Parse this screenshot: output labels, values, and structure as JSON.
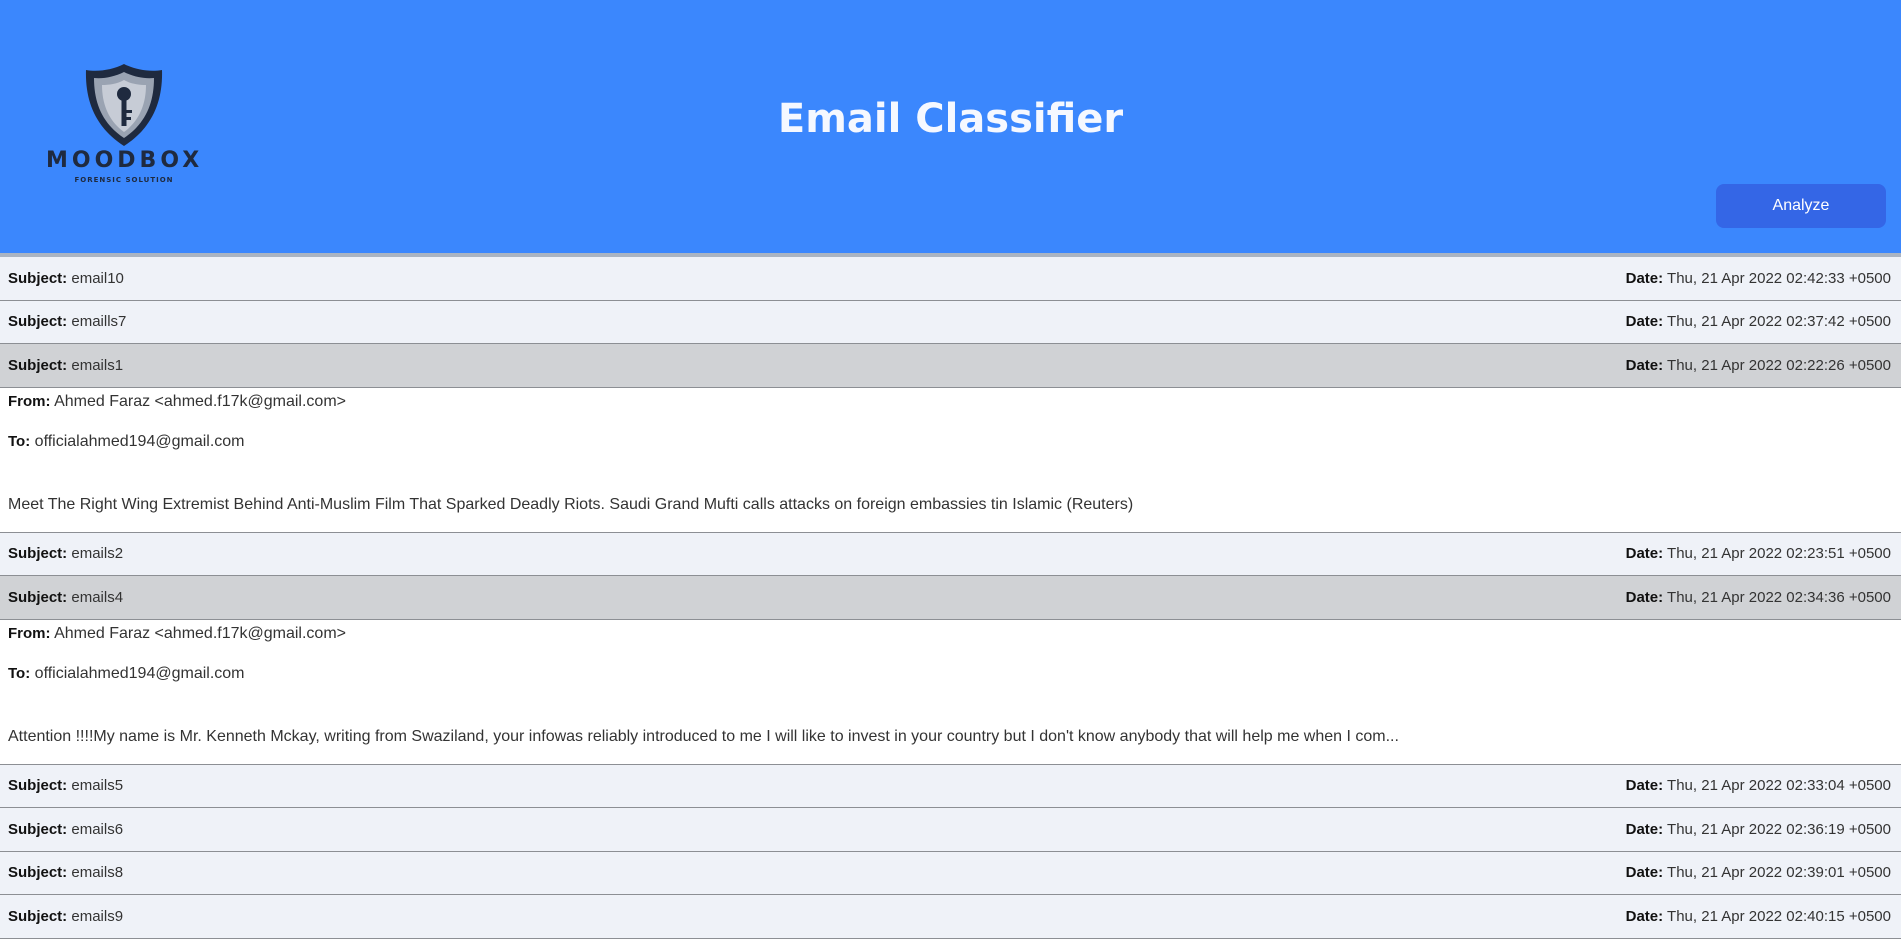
{
  "app": {
    "logo_text": "MOODBOX",
    "logo_subtext": "FORENSIC SOLUTION",
    "title": "Email Classifier",
    "analyze_label": "Analyze"
  },
  "labels": {
    "subject": "Subject:",
    "date": "Date:",
    "from": "From:",
    "to": "To:"
  },
  "emails": [
    {
      "subject": "email10",
      "date": "Thu, 21 Apr 2022 02:42:33 +0500"
    },
    {
      "subject": "emaills7",
      "date": "Thu, 21 Apr 2022 02:37:42 +0500"
    },
    {
      "subject": "emails1",
      "date": "Thu, 21 Apr 2022 02:22:26 +0500",
      "from": "Ahmed Faraz <ahmed.f17k@gmail.com>",
      "to": "officialahmed194@gmail.com",
      "body": "Meet The Right Wing Extremist Behind Anti-Muslim Film That Sparked Deadly Riots. Saudi Grand Mufti calls attacks on foreign embassies tin Islamic (Reuters)"
    },
    {
      "subject": "emails2",
      "date": "Thu, 21 Apr 2022 02:23:51 +0500"
    },
    {
      "subject": "emails4",
      "date": "Thu, 21 Apr 2022 02:34:36 +0500",
      "from": "Ahmed Faraz <ahmed.f17k@gmail.com>",
      "to": "officialahmed194@gmail.com",
      "body": "Attention !!!!My name is Mr. Kenneth Mckay, writing from Swaziland, your infowas reliably introduced to me I will like to invest in your country but I don't know anybody that will help me when I com..."
    },
    {
      "subject": "emails5",
      "date": "Thu, 21 Apr 2022 02:33:04 +0500"
    },
    {
      "subject": "emails6",
      "date": "Thu, 21 Apr 2022 02:36:19 +0500"
    },
    {
      "subject": "emails8",
      "date": "Thu, 21 Apr 2022 02:39:01 +0500"
    },
    {
      "subject": "emails9",
      "date": "Thu, 21 Apr 2022 02:40:15 +0500"
    }
  ]
}
